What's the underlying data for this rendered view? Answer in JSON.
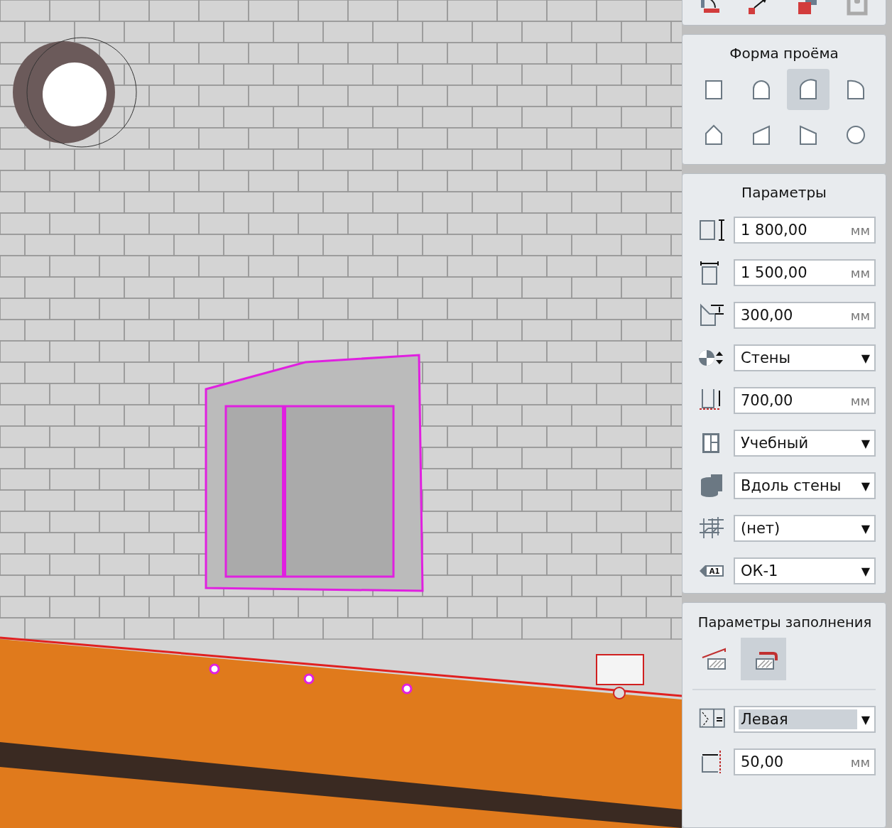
{
  "opening_shape": {
    "title": "Форма проёма",
    "shapes": [
      {
        "kind": "rect",
        "selected": false
      },
      {
        "kind": "arch",
        "selected": false
      },
      {
        "kind": "quarter-left",
        "selected": true
      },
      {
        "kind": "quarter-right",
        "selected": false
      },
      {
        "kind": "gable",
        "selected": false
      },
      {
        "kind": "slope-left",
        "selected": false
      },
      {
        "kind": "slope-right",
        "selected": false
      },
      {
        "kind": "circle",
        "selected": false
      }
    ]
  },
  "parameters": {
    "title": "Параметры",
    "fields": [
      {
        "kind": "number",
        "value": "1 800,00",
        "unit": "мм"
      },
      {
        "kind": "number",
        "value": "1 500,00",
        "unit": "мм"
      },
      {
        "kind": "number",
        "value": "300,00",
        "unit": "мм"
      },
      {
        "kind": "dropdown",
        "value": "Стены",
        "arrow": "▼"
      },
      {
        "kind": "number",
        "value": "700,00",
        "unit": "мм"
      },
      {
        "kind": "dropdown",
        "value": "Учебный",
        "arrow": "▼"
      },
      {
        "kind": "dropdown",
        "value": "Вдоль стены",
        "arrow": "▼"
      },
      {
        "kind": "dropdown",
        "value": "(нет)",
        "arrow": "▼"
      },
      {
        "kind": "dropdown",
        "value": "ОК-1",
        "arrow": "▼",
        "icon_text": "A1"
      }
    ]
  },
  "fill_parameters": {
    "title": "Параметры заполнения",
    "modes": [
      {
        "selected": false
      },
      {
        "selected": true
      }
    ],
    "fields": [
      {
        "kind": "dropdown",
        "value": "Левая",
        "arrow": "▼",
        "highlighted": true
      },
      {
        "kind": "number",
        "value": "50,00",
        "unit": "мм"
      }
    ]
  }
}
